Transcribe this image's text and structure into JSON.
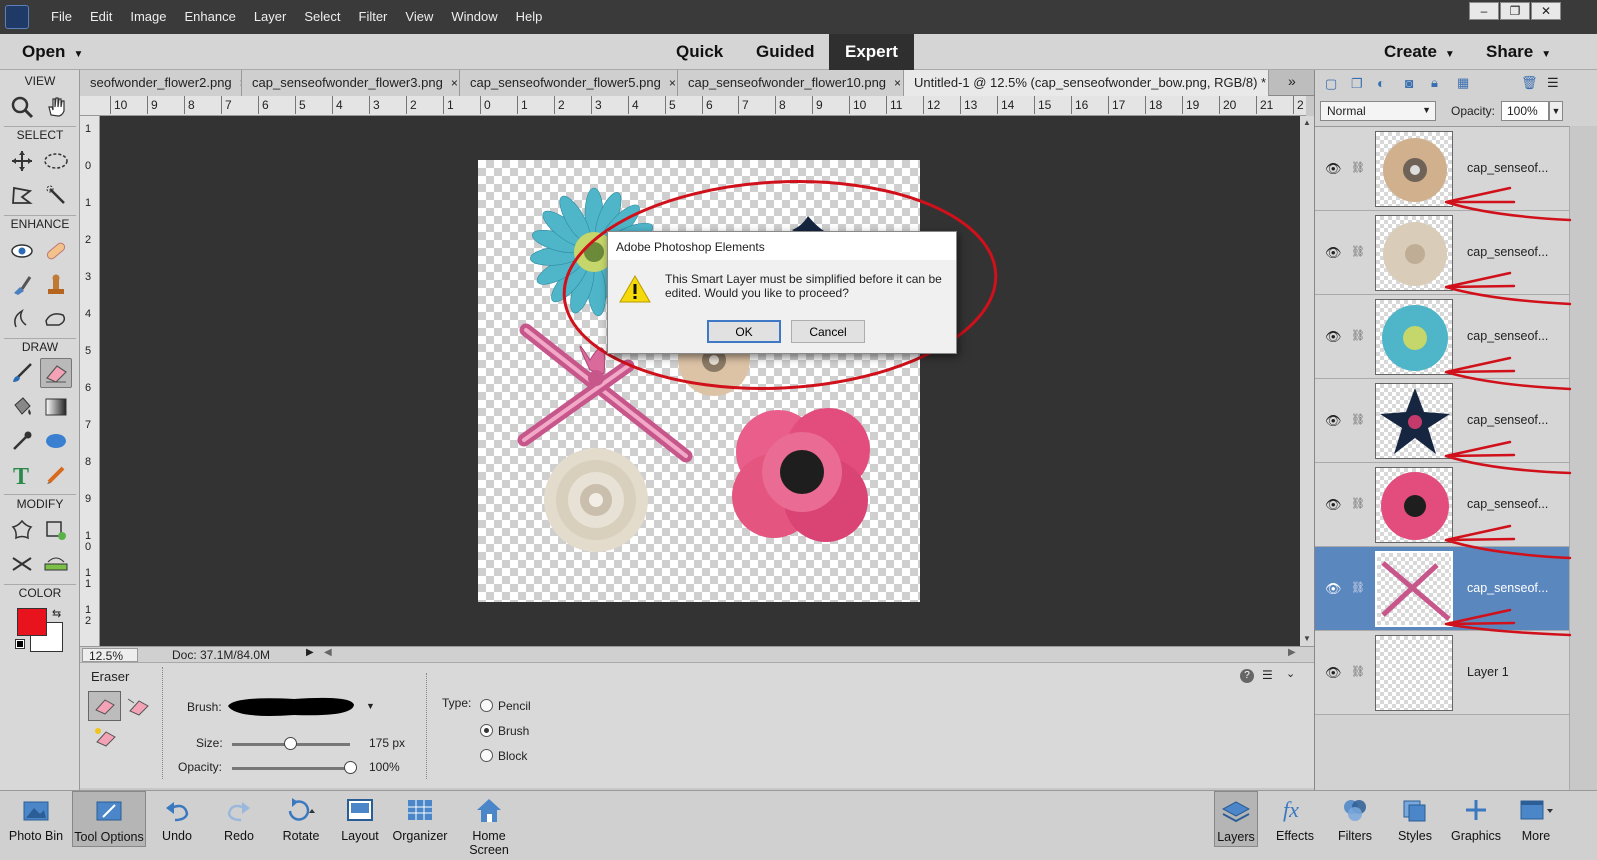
{
  "menu": [
    "File",
    "Edit",
    "Image",
    "Enhance",
    "Layer",
    "Select",
    "Filter",
    "View",
    "Window",
    "Help"
  ],
  "window_controls": [
    "–",
    "❐",
    "✕"
  ],
  "modebar": {
    "open": "Open",
    "quick": "Quick",
    "guided": "Guided",
    "expert": "Expert",
    "create": "Create",
    "share": "Share"
  },
  "toolbox": {
    "view": "VIEW",
    "select": "SELECT",
    "enhance": "ENHANCE",
    "draw": "DRAW",
    "modify": "MODIFY",
    "color": "COLOR",
    "fg_color": "#e8131c",
    "bg_color": "#ffffff"
  },
  "tabs": [
    {
      "label": "seofwonder_flower2.png",
      "close": "×"
    },
    {
      "label": "cap_senseofwonder_flower3.png",
      "close": "×"
    },
    {
      "label": "cap_senseofwonder_flower5.png",
      "close": "×"
    },
    {
      "label": "cap_senseofwonder_flower10.png",
      "close": "×"
    },
    {
      "label": "Untitled-1 @ 12.5% (cap_senseofwonder_bow.png, RGB/8) *",
      "close": "×"
    }
  ],
  "tab_overflow": "»",
  "hruler": [
    "10",
    "9",
    "8",
    "7",
    "6",
    "5",
    "4",
    "3",
    "2",
    "1",
    "0",
    "1",
    "2",
    "3",
    "4",
    "5",
    "6",
    "7",
    "8",
    "9",
    "10",
    "11",
    "12",
    "13",
    "14",
    "15",
    "16",
    "17",
    "18",
    "19",
    "20",
    "21",
    "2"
  ],
  "vruler": [
    "1",
    "0",
    "1",
    "2",
    "3",
    "4",
    "5",
    "6",
    "7",
    "8",
    "9",
    "1 0",
    "1 1",
    "1 2"
  ],
  "status": {
    "zoom": "12.5%",
    "doc": "Doc: 37.1M/84.0M"
  },
  "tool_options": {
    "title": "Eraser",
    "brush_label": "Brush:",
    "size_label": "Size:",
    "size_value": "175 px",
    "size_level": 0.49,
    "opacity_label": "Opacity:",
    "opacity_value": "100%",
    "opacity_level": 1.0,
    "type_label": "Type:",
    "types": [
      "Pencil",
      "Brush",
      "Block"
    ],
    "selected_type": "Brush"
  },
  "layers_panel": {
    "blend_mode": "Normal",
    "opacity_label": "Opacity:",
    "opacity_value": "100%",
    "layers": [
      {
        "name": "cap_senseof...",
        "selected": false
      },
      {
        "name": "cap_senseof...",
        "selected": false
      },
      {
        "name": "cap_senseof...",
        "selected": false
      },
      {
        "name": "cap_senseof...",
        "selected": false
      },
      {
        "name": "cap_senseof...",
        "selected": false
      },
      {
        "name": "cap_senseof...",
        "selected": true
      },
      {
        "name": "Layer 1",
        "selected": false
      }
    ]
  },
  "dialog": {
    "title": "Adobe Photoshop Elements",
    "message": "This Smart Layer must be simplified before it can be edited. Would you like to proceed?",
    "ok": "OK",
    "cancel": "Cancel"
  },
  "bottom_left": [
    "Photo Bin",
    "Tool Options",
    "Undo",
    "Redo",
    "Rotate",
    "Layout",
    "Organizer",
    "Home Screen"
  ],
  "bottom_right": [
    "Layers",
    "Effects",
    "Filters",
    "Styles",
    "Graphics",
    "More"
  ],
  "annotation_color": "#d0101a"
}
